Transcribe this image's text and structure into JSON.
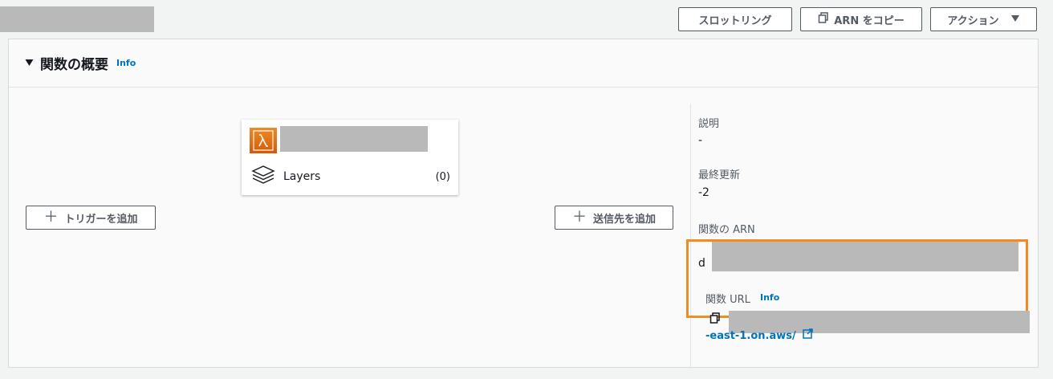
{
  "toolbar": {
    "throttle_label": "スロットリング",
    "copy_arn_label": "ARN をコピー",
    "actions_label": "アクション"
  },
  "overview": {
    "title": "関数の概要",
    "info_label": "Info",
    "layers_label": "Layers",
    "layers_count": "(0)",
    "add_trigger_label": "トリガーを追加",
    "add_destination_label": "送信先を追加"
  },
  "details": {
    "description_label": "説明",
    "description_value": "-",
    "last_modified_label": "最終更新",
    "last_modified_value": "-2",
    "arn_label": "関数の ARN",
    "arn_value_fragment": "d",
    "url_label": "関数 URL",
    "url_info_label": "Info",
    "url_link_fragment": "-east-1.on.aws/"
  },
  "colors": {
    "accent_orange": "#f28b24",
    "link_blue": "#0073bb",
    "lambda_orange": "#e8700a"
  },
  "icons": {
    "copy": "copy-icon",
    "caret_down": "caret-down-icon",
    "lambda": "lambda-icon",
    "layers": "layers-icon",
    "plus": "plus-icon",
    "external_link": "external-link-icon"
  }
}
